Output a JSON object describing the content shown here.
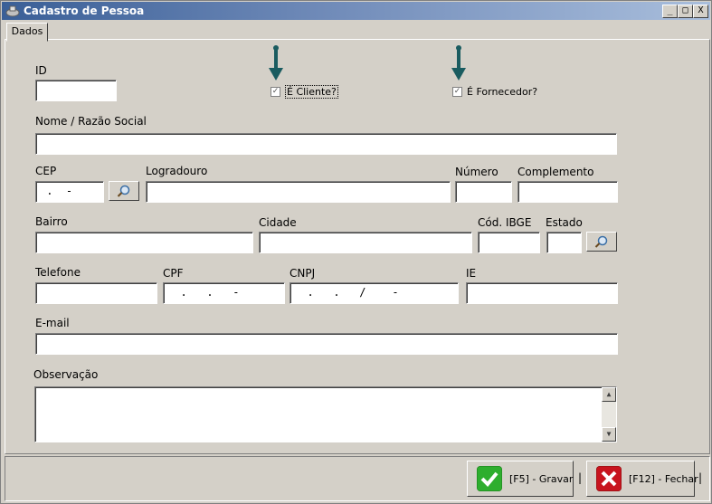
{
  "window": {
    "title": "Cadastro de Pessoa",
    "min_glyph": "_",
    "max_glyph": "□",
    "close_glyph": "X"
  },
  "tabs": [
    {
      "label": "Dados",
      "active": true
    }
  ],
  "form": {
    "id_label": "ID",
    "id_value": "",
    "cliente_label": "É Cliente?",
    "cliente_checked": true,
    "fornecedor_label": "É Fornecedor?",
    "fornecedor_checked": true,
    "nome_label": "Nome / Razão Social",
    "nome_value": "",
    "cep_label": "CEP",
    "cep_value": " .  -",
    "logradouro_label": "Logradouro",
    "numero_label": "Número",
    "complemento_label": "Complemento",
    "bairro_label": "Bairro",
    "cidade_label": "Cidade",
    "ibge_label": "Cód. IBGE",
    "estado_label": "Estado",
    "telefone_label": "Telefone",
    "cpf_label": "CPF",
    "cpf_value": "  .   .   -",
    "cnpj_label": "CNPJ",
    "cnpj_value": "  .   .   /    -",
    "ie_label": "IE",
    "email_label": "E-mail",
    "obs_label": "Observação"
  },
  "footer": {
    "save_label": "[F5] - Gravar",
    "close_label": "[F12] - Fechar",
    "separator": "|"
  },
  "colors": {
    "titlebar": "#3a5f97",
    "face": "#d4d0c8",
    "arrow": "#1a5c60",
    "save_icon": "#2eae2e",
    "close_icon": "#c8141e"
  }
}
